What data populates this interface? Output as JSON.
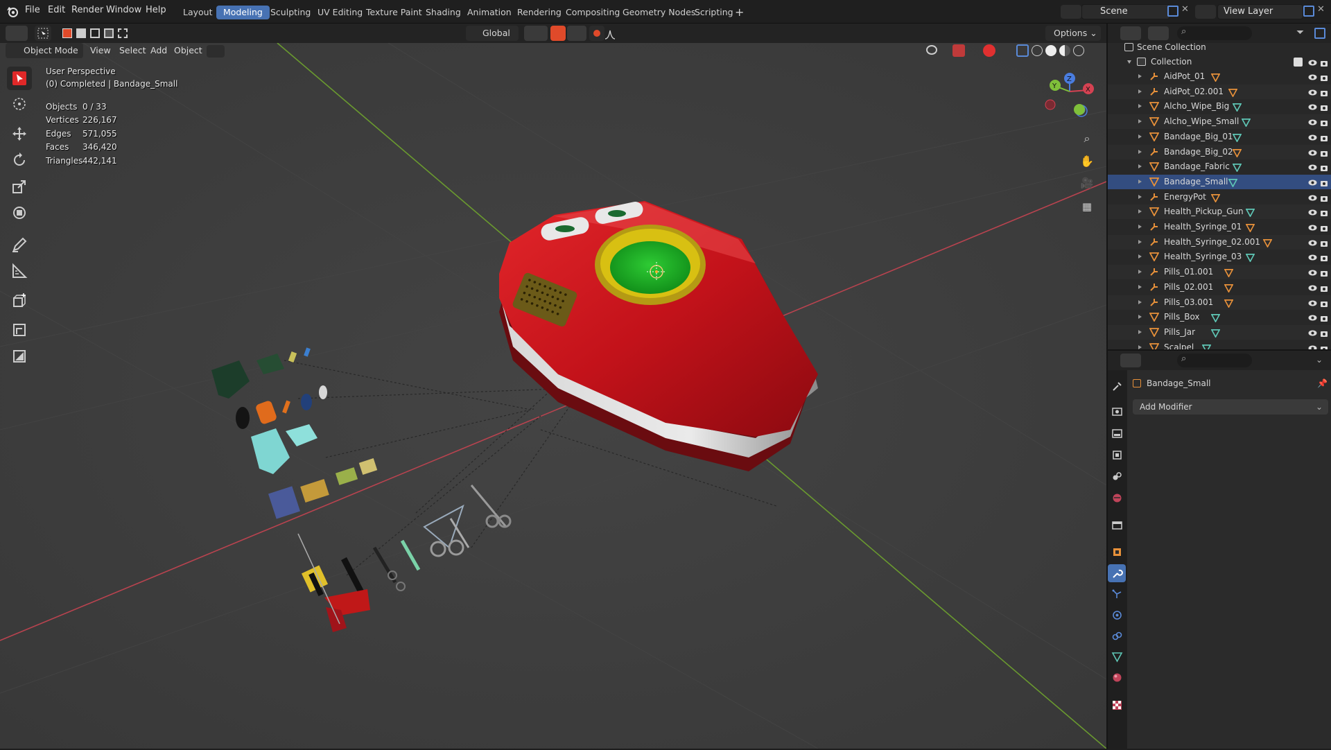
{
  "menu": [
    "File",
    "Edit",
    "Render",
    "Window",
    "Help"
  ],
  "workspaces": [
    "Layout",
    "Modeling",
    "Sculpting",
    "UV Editing",
    "Texture Paint",
    "Shading",
    "Animation",
    "Rendering",
    "Compositing",
    "Geometry Nodes",
    "Scripting"
  ],
  "active_workspace": "Modeling",
  "scene": "Scene",
  "view_layer": "View Layer",
  "header": {
    "transform_orientation": "Global",
    "options": "Options"
  },
  "viewport_header": {
    "mode": "Object Mode",
    "view": "View",
    "select": "Select",
    "add": "Add",
    "object": "Object"
  },
  "overlay": {
    "perspective": "User Perspective",
    "status": "(0) Completed | Bandage_Small",
    "stats": [
      {
        "label": "Objects",
        "value": "0 / 33"
      },
      {
        "label": "Vertices",
        "value": "226,167"
      },
      {
        "label": "Edges",
        "value": "571,055"
      },
      {
        "label": "Faces",
        "value": "346,420"
      },
      {
        "label": "Triangles",
        "value": "442,141"
      }
    ]
  },
  "outliner": {
    "scene_collection": "Scene Collection",
    "collection": "Collection",
    "items": [
      {
        "name": "AidPot_01",
        "type": "armature",
        "data": "mesh-orange"
      },
      {
        "name": "AidPot_02.001",
        "type": "armature",
        "data": "mesh-orange"
      },
      {
        "name": "Alcho_Wipe_Big",
        "type": "mesh",
        "data": "mesh-teal"
      },
      {
        "name": "Alcho_Wipe_Small",
        "type": "mesh",
        "data": "mesh-teal"
      },
      {
        "name": "Bandage_Big_01",
        "type": "mesh",
        "data": "mesh-teal"
      },
      {
        "name": "Bandage_Big_02",
        "type": "armature",
        "data": "mesh-orange"
      },
      {
        "name": "Bandage_Fabric",
        "type": "mesh",
        "data": "mesh-teal"
      },
      {
        "name": "Bandage_Small",
        "type": "mesh",
        "data": "mesh-teal"
      },
      {
        "name": "EnergyPot",
        "type": "armature",
        "data": "mesh-orange"
      },
      {
        "name": "Health_Pickup_Gun",
        "type": "mesh",
        "data": "mesh-teal"
      },
      {
        "name": "Health_Syringe_01",
        "type": "armature",
        "data": "mesh-orange"
      },
      {
        "name": "Health_Syringe_02.001",
        "type": "armature",
        "data": "mesh-orange"
      },
      {
        "name": "Health_Syringe_03",
        "type": "mesh",
        "data": "mesh-teal"
      },
      {
        "name": "Pills_01.001",
        "type": "armature",
        "data": "mesh-orange"
      },
      {
        "name": "Pills_02.001",
        "type": "armature",
        "data": "mesh-orange"
      },
      {
        "name": "Pills_03.001",
        "type": "armature",
        "data": "mesh-orange"
      },
      {
        "name": "Pills_Box",
        "type": "mesh",
        "data": "mesh-teal"
      },
      {
        "name": "Pills_Jar",
        "type": "mesh",
        "data": "mesh-teal"
      },
      {
        "name": "Scalpel",
        "type": "mesh",
        "data": "mesh-teal"
      }
    ]
  },
  "properties": {
    "object_name": "Bandage_Small",
    "add_modifier": "Add Modifier"
  },
  "colors": {
    "accent": "#4772b3",
    "x_axis": "#b9434f",
    "y_axis": "#6a9a2f",
    "object_red": "#c8141c",
    "mesh_orange": "#e8913a",
    "mesh_teal": "#5fc7b6"
  }
}
